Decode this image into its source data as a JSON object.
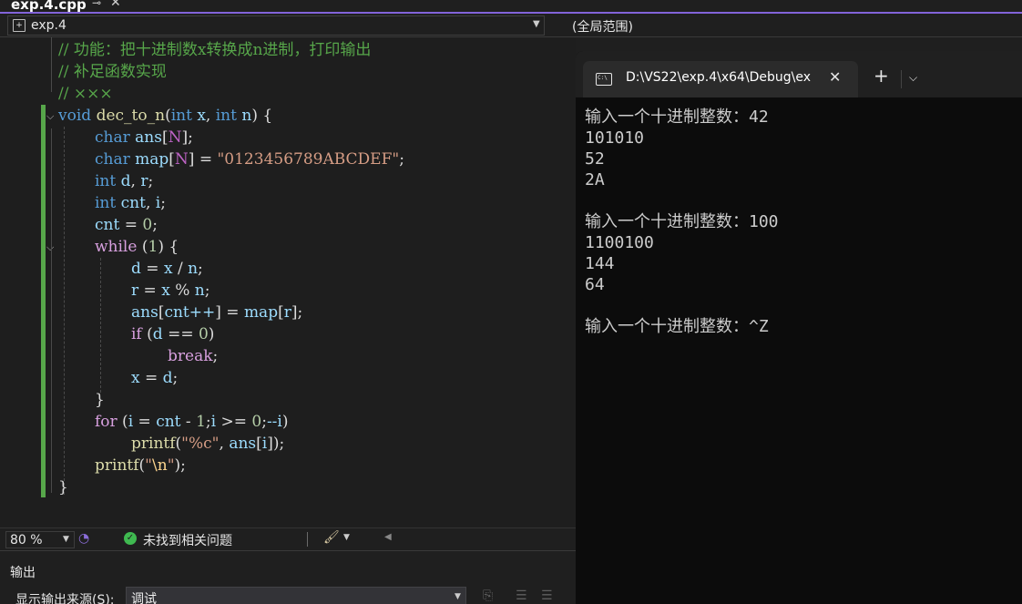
{
  "tab": {
    "title": "exp.4.cpp",
    "pin_glyph": "⊸",
    "close_glyph": "✕"
  },
  "navbar": {
    "scope": "exp.4",
    "global_scope": "(全局范围)"
  },
  "editor": {
    "comments": [
      "// 功能：把十进制数x转换成n进制，打印输出",
      "// 补足函数实现",
      "// ×××"
    ],
    "func_sig": {
      "kw_void": "void",
      "name": "dec_to_n",
      "p1_type": "int",
      "p1": "x",
      "p2_type": "int",
      "p2": "n"
    },
    "decl_ans": {
      "type": "char",
      "name": "ans",
      "size": "N"
    },
    "decl_map": {
      "type": "char",
      "name": "map",
      "size": "N",
      "init": "\"0123456789ABCDEF\""
    },
    "decl_dr": {
      "type": "int",
      "a": "d",
      "b": "r"
    },
    "decl_cnt": {
      "type": "int",
      "a": "cnt",
      "b": "i"
    },
    "init_cnt": {
      "var": "cnt",
      "val": "0"
    },
    "while_line": {
      "kw": "while",
      "cond": "1"
    },
    "stmt_d": {
      "lhs": "d",
      "a": "x",
      "op": "/",
      "b": "n"
    },
    "stmt_r": {
      "lhs": "r",
      "a": "x",
      "op": "%",
      "b": "n"
    },
    "stmt_ans": {
      "arr": "ans",
      "idx": "cnt++",
      "rhs_arr": "map",
      "rhs_idx": "r"
    },
    "if_line": {
      "kw": "if",
      "var": "d",
      "val": "0"
    },
    "break_kw": "break",
    "stmt_x": {
      "lhs": "x",
      "rhs": "d"
    },
    "for_line": {
      "kw": "for",
      "i": "i",
      "cnt": "cnt",
      "one": "1",
      "i2": "i",
      "zero": "0",
      "dec": "--i"
    },
    "printf1": {
      "fn": "printf",
      "fmt": "\"%c\"",
      "arr": "ans",
      "idx": "i"
    },
    "printf2": {
      "fn": "printf",
      "q1": "\"",
      "esc": "\\n",
      "q2": "\""
    }
  },
  "status": {
    "zoom": "80 %",
    "issues": "未找到相关问题"
  },
  "output": {
    "title": "输出",
    "source_label": "显示输出来源(S):",
    "source_value": "调试"
  },
  "terminal": {
    "title": "D:\\VS22\\exp.4\\x64\\Debug\\ex",
    "icon_text": "C:\\",
    "lines": [
      "输入一个十进制整数：42",
      "101010",
      "52",
      "2A",
      "",
      "输入一个十进制整数：100",
      "1100100",
      "144",
      "64",
      "",
      "输入一个十进制整数：^Z"
    ]
  },
  "colors": {
    "accent": "#8263d9",
    "comment": "#57a64a",
    "keyword": "#569cd6",
    "control": "#d8a0df",
    "string": "#d69d85",
    "terminal_bg": "#0c0c0c"
  }
}
